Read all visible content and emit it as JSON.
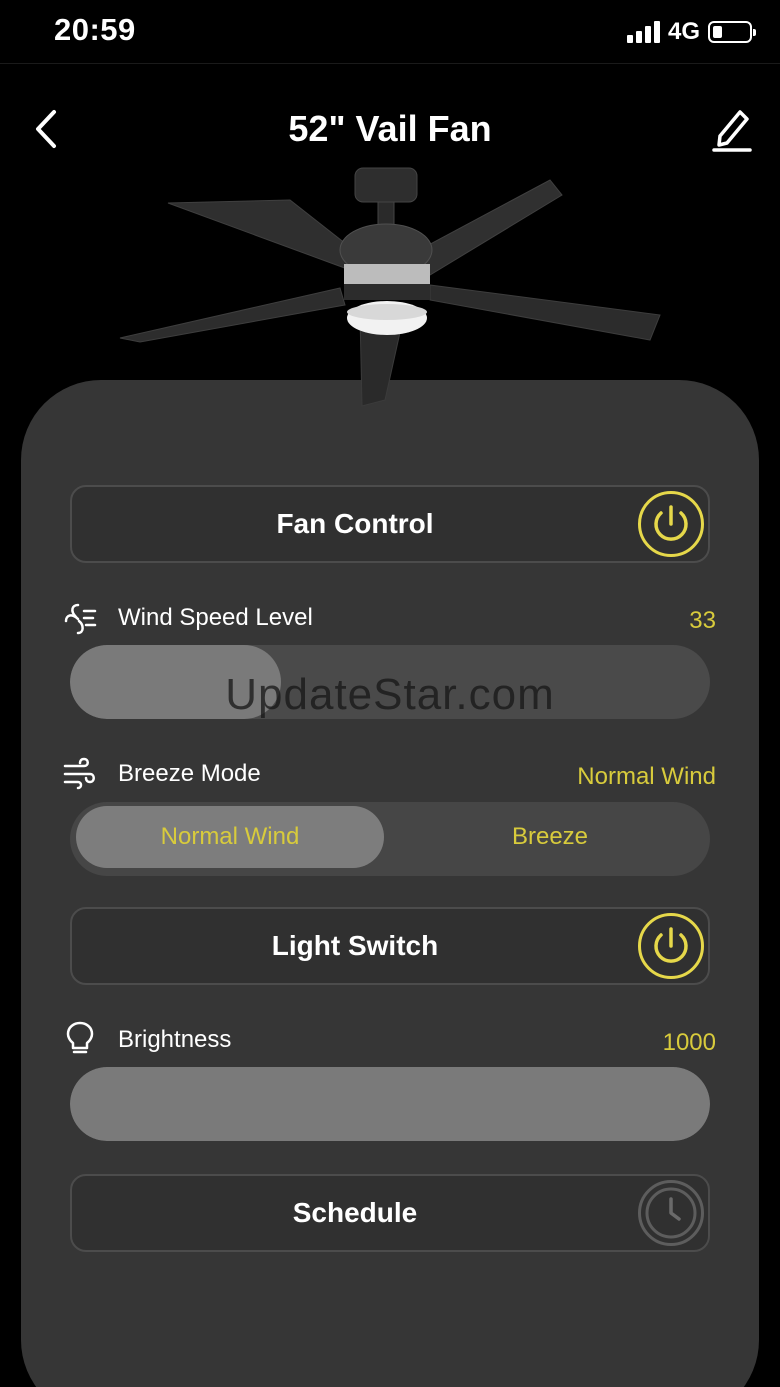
{
  "status_bar": {
    "time": "20:59",
    "network": "4G",
    "battery_level": 0.25
  },
  "header": {
    "title": "52\" Vail Fan",
    "back_icon": "chevron-left-icon",
    "edit_icon": "pencil-icon"
  },
  "fan_control": {
    "label": "Fan Control",
    "power_icon": "power-icon"
  },
  "wind_speed": {
    "label": "Wind Speed Level",
    "value": "33",
    "level_fraction": 0.33,
    "icon": "fan-wind-icon"
  },
  "breeze_mode": {
    "label": "Breeze Mode",
    "value": "Normal Wind",
    "icon": "wind-icon",
    "options": [
      "Normal Wind",
      "Breeze"
    ],
    "selected_index": 0
  },
  "light_switch": {
    "label": "Light Switch",
    "power_icon": "power-icon"
  },
  "brightness": {
    "label": "Brightness",
    "value": "1000",
    "level_fraction": 1.0,
    "icon": "lightbulb-icon"
  },
  "schedule": {
    "label": "Schedule",
    "icon": "clock-icon"
  },
  "watermark": "UpdateStar.com",
  "colors": {
    "accent": "#e6d84a",
    "card": "#363636",
    "background": "#000000"
  }
}
